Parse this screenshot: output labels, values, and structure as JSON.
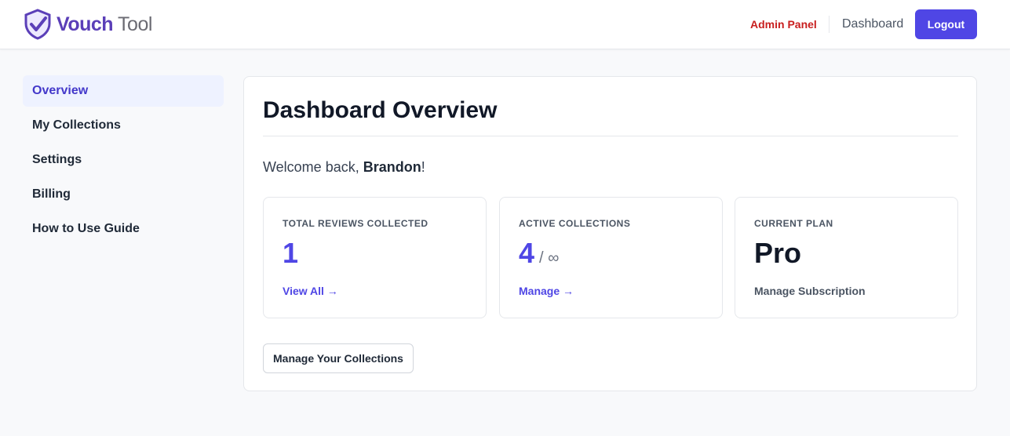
{
  "brand": {
    "name_part1": "Vouch",
    "name_part2": "Tool",
    "accent": "#5b3fb8"
  },
  "header": {
    "admin_link": "Admin Panel",
    "dashboard_link": "Dashboard",
    "logout_label": "Logout"
  },
  "sidebar": {
    "items": [
      {
        "label": "Overview",
        "active": true
      },
      {
        "label": "My Collections"
      },
      {
        "label": "Settings"
      },
      {
        "label": "Billing"
      },
      {
        "label": "How to Use Guide"
      }
    ]
  },
  "main": {
    "title": "Dashboard Overview",
    "welcome_prefix": "Welcome back, ",
    "user_name": "Brandon",
    "welcome_suffix": "!",
    "stats": [
      {
        "label": "Total Reviews Collected",
        "value": "1",
        "link": "View All →"
      },
      {
        "label": "Active Collections",
        "value": "4",
        "suffix": "/ ∞",
        "link": "Manage →"
      },
      {
        "label": "Current Plan",
        "value": "Pro",
        "link": "Manage Subscription"
      }
    ],
    "manage_button": "Manage Your Collections"
  },
  "colors": {
    "primary": "#4f46e5",
    "danger": "#c81e1e",
    "active_bg": "#eef2ff"
  }
}
